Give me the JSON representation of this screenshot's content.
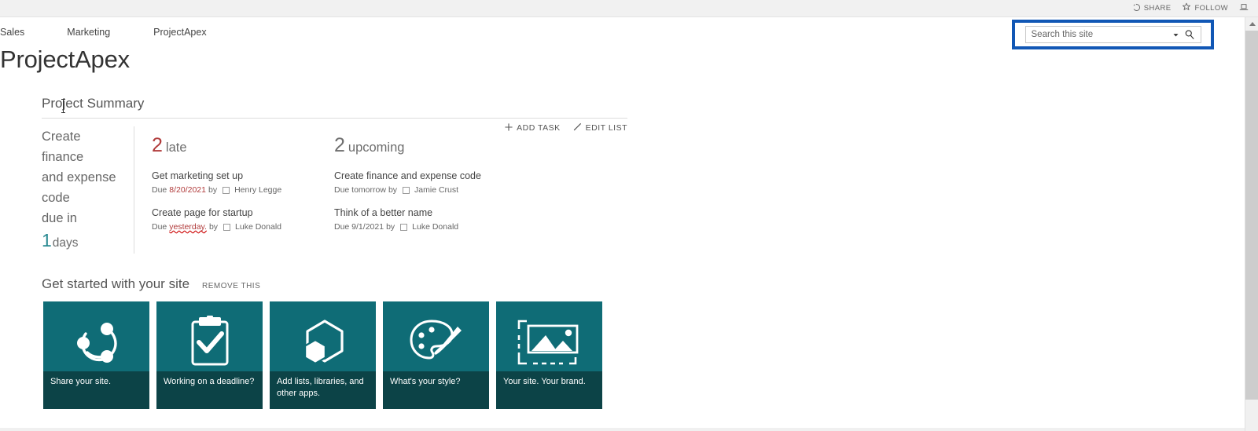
{
  "suitebar": {
    "actions": [
      {
        "label": "SHARE",
        "icon": "share-icon"
      },
      {
        "label": "FOLLOW",
        "icon": "star-icon"
      },
      {
        "label": "",
        "icon": "focus-on-content-icon"
      }
    ]
  },
  "search": {
    "placeholder": "Search this site",
    "value": "",
    "caret_icon": "chevron-down-icon",
    "go_icon": "magnifier-icon",
    "focus_ring_color": "#1157b5"
  },
  "topnav": {
    "items": [
      {
        "label": "Sales"
      },
      {
        "label": "Marketing"
      },
      {
        "label": "ProjectApex"
      }
    ]
  },
  "site": {
    "title": "ProjectApex"
  },
  "project_summary": {
    "heading": "Project Summary",
    "toolbar": {
      "add_task": "ADD TASK",
      "edit_list": "EDIT LIST",
      "add_icon": "plus-icon",
      "edit_icon": "pencil-icon"
    },
    "summary_left": {
      "text": "Create finance and expense code due in",
      "lines": [
        "Create finance",
        "and expense",
        "code",
        "due in"
      ],
      "count": "1",
      "unit": "days",
      "count_color": "#2a8a92"
    },
    "columns": [
      {
        "count": "2",
        "word": "late",
        "count_color": "#b03a3a",
        "tasks": [
          {
            "title": "Get marketing set up",
            "due_prefix": "Due",
            "due_value": "8/20/2021",
            "by": "by",
            "assignee": "Henry Legge",
            "spellcheck_underline": false
          },
          {
            "title": "Create page for startup",
            "due_prefix": "Due",
            "due_value": "yesterday.",
            "by": "by",
            "assignee": "Luke Donald",
            "spellcheck_underline": true
          }
        ]
      },
      {
        "count": "2",
        "word": "upcoming",
        "count_color": "#6e6e6e",
        "tasks": [
          {
            "title": "Create finance and expense code",
            "due_prefix": "Due tomorrow",
            "due_value": "",
            "by": "by",
            "assignee": "Jamie Crust",
            "spellcheck_underline": false
          },
          {
            "title": "Think of a better name",
            "due_prefix": "Due 9/1/2021",
            "due_value": "",
            "by": "by",
            "assignee": "Luke Donald",
            "spellcheck_underline": false
          }
        ]
      }
    ]
  },
  "get_started": {
    "title": "Get started with your site",
    "remove_label": "REMOVE THIS",
    "tile_bg": "#0f6c76",
    "tile_foot_bg": "#0c4347",
    "tiles": [
      {
        "label": "Share your site.",
        "icon": "share-nodes-icon"
      },
      {
        "label": "Working on a deadline?",
        "icon": "clipboard-check-icon"
      },
      {
        "label": "Add lists, libraries, and other apps.",
        "icon": "hexagon-apps-icon"
      },
      {
        "label": "What's your style?",
        "icon": "palette-brush-icon"
      },
      {
        "label": "Your site. Your brand.",
        "icon": "image-frame-icon"
      }
    ]
  },
  "scrollbars": {
    "vertical_up_icon": "arrow-up-icon"
  }
}
